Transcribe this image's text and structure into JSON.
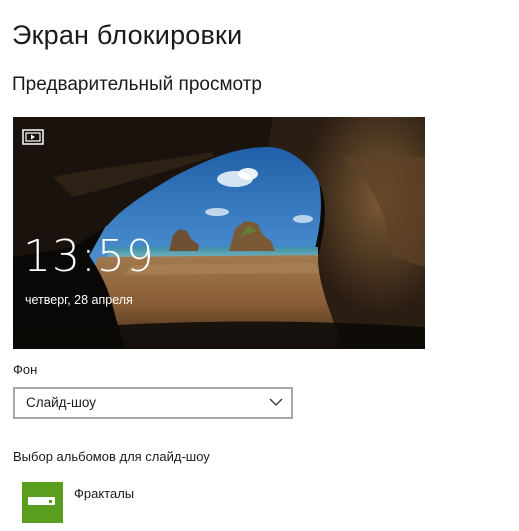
{
  "page": {
    "title": "Экран блокировки",
    "preview_heading": "Предварительный просмотр"
  },
  "preview": {
    "time": "13:59",
    "date": "четверг, 28 апреля"
  },
  "background": {
    "label": "Фон",
    "selected": "Слайд-шоу"
  },
  "albums": {
    "label": "Выбор альбомов для слайд-шоу",
    "items": [
      {
        "name": "Фракталы",
        "tile_color": "#5a9e1f",
        "icon": "drive-icon"
      }
    ]
  },
  "colors": {
    "accent_tile": "#5a9e1f",
    "select_border": "#a8a8a8"
  }
}
